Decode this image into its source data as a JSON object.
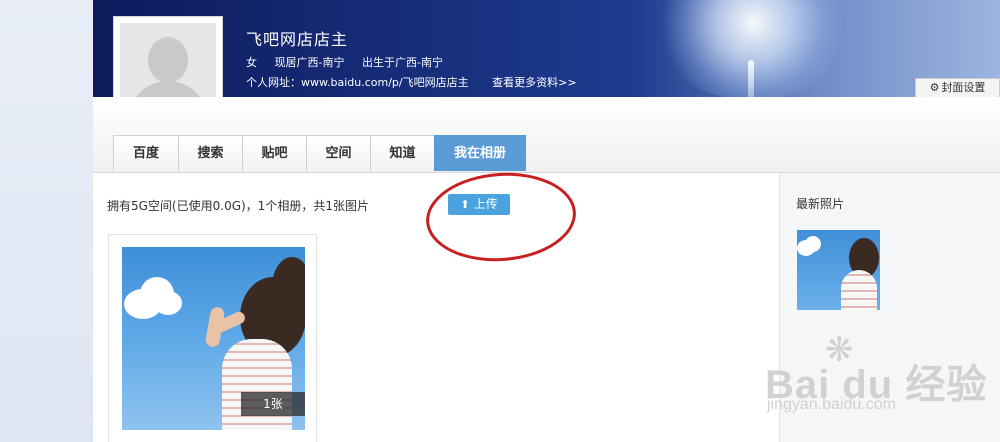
{
  "profile": {
    "name": "飞吧网店店主",
    "gender": "女",
    "residence": "现居广西-南宁",
    "birthplace": "出生于广西-南宁",
    "url_label": "个人网址：",
    "url_value": "www.baidu.com/p/飞吧网店店主",
    "more_info": "查看更多资料>>",
    "online_color": "#5cb85c"
  },
  "cover": {
    "settings_label": "封面设置",
    "settings_icon": "gear-icon"
  },
  "tabs": [
    {
      "label": "百度"
    },
    {
      "label": "搜索"
    },
    {
      "label": "贴吧"
    },
    {
      "label": "空间"
    },
    {
      "label": "知道"
    },
    {
      "label": "我在相册",
      "active": true
    }
  ],
  "main": {
    "storage_info": "拥有5G空间(已使用0.0G)，1个相册，共1张图片",
    "upload_label": "上传",
    "upload_icon": "upload-arrow-icon",
    "album_count": "1张",
    "accent_color": "#4aa3df",
    "highlight_color": "#c81f1f"
  },
  "sidebar": {
    "title": "最新照片"
  },
  "watermark": {
    "brand": "Bai du 经验",
    "sub": "jingyan.baidu.com"
  }
}
